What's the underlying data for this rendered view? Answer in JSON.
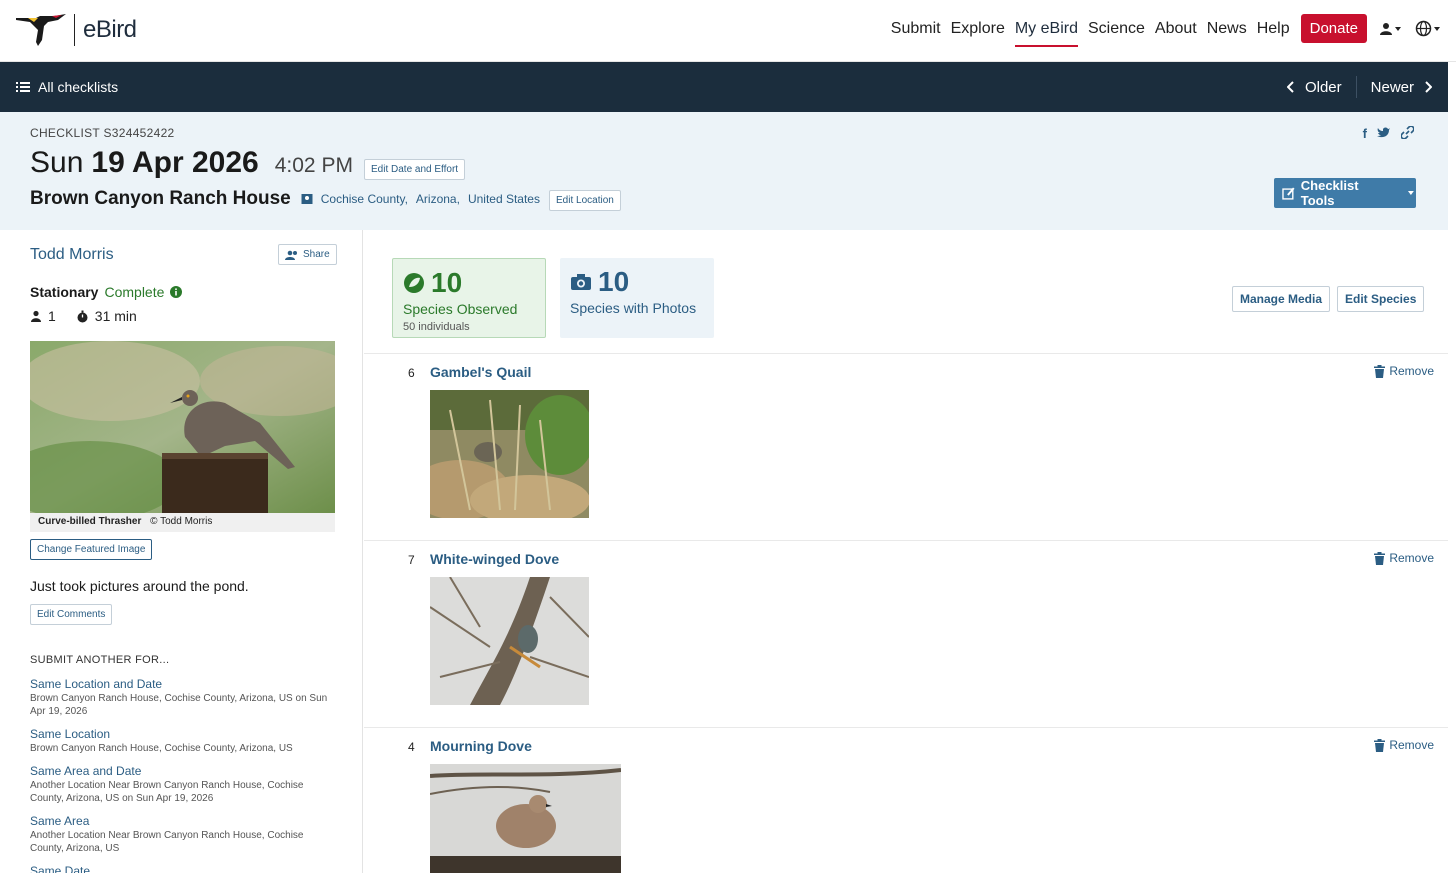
{
  "nav": {
    "logo_text": "eBird",
    "items": [
      "Submit",
      "Explore",
      "My eBird",
      "Science",
      "About",
      "News",
      "Help"
    ],
    "donate": "Donate",
    "accent": "#c8102e"
  },
  "bar": {
    "all_checklists": "All checklists",
    "older": "Older",
    "newer": "Newer"
  },
  "header": {
    "checklist_id": "CHECKLIST S324452422",
    "day": "Sun",
    "date": "19 Apr 2026",
    "time": "4:02 PM",
    "edit_date": "Edit Date and Effort",
    "location": "Brown Canyon Ranch House",
    "county": "Cochise County,",
    "state": "Arizona,",
    "country": "United States",
    "edit_location": "Edit Location",
    "checklist_tools": "Checklist Tools"
  },
  "sidebar": {
    "observer": "Todd Morris",
    "share": "Share",
    "protocol": "Stationary",
    "status": "Complete",
    "observers": "1",
    "duration": "31 min",
    "featured_species": "Curve-billed Thrasher",
    "featured_credit": "© Todd Morris",
    "change_image": "Change Featured Image",
    "comment": "Just took pictures around the pond.",
    "edit_comments": "Edit Comments",
    "submit_heading": "SUBMIT ANOTHER FOR...",
    "submit_links": [
      {
        "title": "Same Location and Date",
        "desc": "Brown Canyon Ranch House, Cochise County, Arizona, US on Sun Apr 19, 2026"
      },
      {
        "title": "Same Location",
        "desc": "Brown Canyon Ranch House, Cochise County, Arizona, US"
      },
      {
        "title": "Same Area and Date",
        "desc": "Another Location Near Brown Canyon Ranch House, Cochise County, Arizona, US on Sun Apr 19, 2026"
      },
      {
        "title": "Same Area",
        "desc": "Another Location Near Brown Canyon Ranch House, Cochise County, Arizona, US"
      },
      {
        "title": "Same Date",
        "desc": ""
      }
    ]
  },
  "summary": {
    "observed_count": "10",
    "observed_label": "Species Observed",
    "individuals": "50 individuals",
    "photo_count": "10",
    "photo_label": "Species with Photos",
    "manage_media": "Manage Media",
    "edit_species": "Edit Species"
  },
  "species": [
    {
      "count": "6",
      "name": "Gambel's Quail",
      "remove": "Remove"
    },
    {
      "count": "7",
      "name": "White-winged Dove",
      "remove": "Remove"
    },
    {
      "count": "4",
      "name": "Mourning Dove",
      "remove": "Remove"
    }
  ]
}
